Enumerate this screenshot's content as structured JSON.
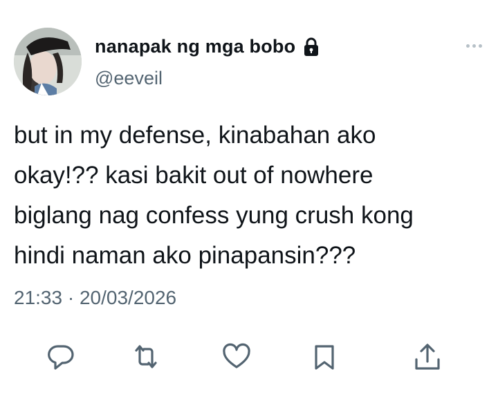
{
  "author": {
    "display_name": "nanapak ng mga bobo",
    "handle": "@eeveil",
    "protected_icon": "lock-icon"
  },
  "tweet": {
    "lines": [
      "but in my defense, kinabahan ako",
      "okay!?? kasi bakit out of nowhere",
      "biglang nag confess yung crush kong",
      "hindi naman ako pinapansin???"
    ],
    "time": "21:33",
    "separator": "·",
    "date": "20/03/2026"
  },
  "actions": [
    {
      "icon": "reply-icon"
    },
    {
      "icon": "retweet-icon"
    },
    {
      "icon": "like-icon"
    },
    {
      "icon": "bookmark-icon"
    },
    {
      "icon": "share-icon"
    }
  ],
  "colors": {
    "text": "#0f1419",
    "secondary": "#536471",
    "more_dots": "#b6c0c7"
  }
}
